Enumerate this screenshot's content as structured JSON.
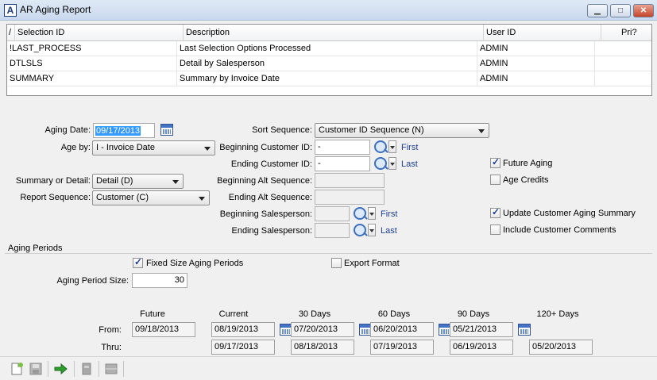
{
  "window": {
    "logo": "A",
    "title": "AR Aging Report",
    "minimize_glyph": "▁",
    "maximize_glyph": "□",
    "close_glyph": "✕"
  },
  "grid": {
    "columns": [
      "Selection ID",
      "Description",
      "User ID",
      "Pri?"
    ],
    "sort_glyph": "/",
    "rows": [
      {
        "id": "!LAST_PROCESS",
        "description": "Last Selection Options Processed",
        "user": "ADMIN",
        "pri": ""
      },
      {
        "id": "DTLSLS",
        "description": "Detail by Salesperson",
        "user": "ADMIN",
        "pri": ""
      },
      {
        "id": "SUMMARY",
        "description": "Summary by Invoice Date",
        "user": "ADMIN",
        "pri": ""
      }
    ]
  },
  "form": {
    "aging_date_label": "Aging Date:",
    "aging_date": "09/17/2013",
    "age_by_label": "Age by:",
    "age_by": "I - Invoice Date",
    "summary_detail_label": "Summary or Detail:",
    "summary_detail": "Detail (D)",
    "report_sequence_label": "Report Sequence:",
    "report_sequence": "Customer (C)",
    "sort_sequence_label": "Sort Sequence:",
    "sort_sequence": "Customer ID Sequence (N)",
    "beg_customer_label": "Beginning Customer ID:",
    "beg_customer": "-",
    "end_customer_label": "Ending Customer ID:",
    "end_customer": "-",
    "beg_alt_label": "Beginning Alt Sequence:",
    "end_alt_label": "Ending Alt Sequence:",
    "beg_sales_label": "Beginning Salesperson:",
    "end_sales_label": "Ending Salesperson:",
    "first_link": "First",
    "last_link": "Last",
    "future_aging_label": "Future Aging",
    "future_aging": true,
    "age_credits_label": "Age Credits",
    "age_credits": false,
    "update_summary_label": "Update Customer Aging Summary",
    "update_summary": true,
    "include_comments_label": "Include Customer Comments",
    "include_comments": false
  },
  "aging": {
    "section_label": "Aging Periods",
    "fixed_size_label": "Fixed Size Aging Periods",
    "fixed_size": true,
    "export_label": "Export Format",
    "export": false,
    "period_size_label": "Aging Period Size:",
    "period_size": "30",
    "from_label": "From:",
    "thru_label": "Thru:",
    "columns": [
      {
        "name": "Future",
        "from": "09/18/2013",
        "thru": ""
      },
      {
        "name": "Current",
        "from": "08/19/2013",
        "thru": "09/17/2013"
      },
      {
        "name": "30 Days",
        "from": "07/20/2013",
        "thru": "08/18/2013"
      },
      {
        "name": "60 Days",
        "from": "06/20/2013",
        "thru": "07/19/2013"
      },
      {
        "name": "90 Days",
        "from": "05/21/2013",
        "thru": "06/19/2013"
      },
      {
        "name": "120+ Days",
        "from": "",
        "thru": "05/20/2013"
      }
    ]
  },
  "icons": {
    "new": "new-document-icon",
    "save": "save-icon",
    "process": "green-arrow-icon",
    "print": "print-icon",
    "grid": "grid-icon"
  }
}
